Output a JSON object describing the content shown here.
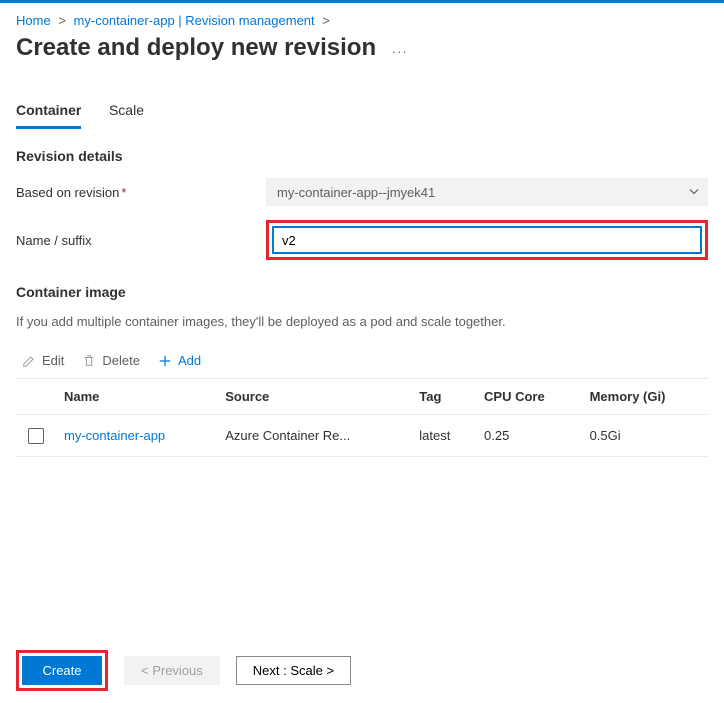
{
  "breadcrumb": {
    "home": "Home",
    "item": "my-container-app | Revision management"
  },
  "page": {
    "title": "Create and deploy new revision"
  },
  "tabs": {
    "container": "Container",
    "scale": "Scale"
  },
  "revision_details": {
    "title": "Revision details",
    "based_on_label": "Based on revision",
    "based_on_value": "my-container-app--jmyek41",
    "name_suffix_label": "Name / suffix",
    "name_suffix_value": "v2"
  },
  "container_image": {
    "title": "Container image",
    "helper": "If you add multiple container images, they'll be deployed as a pod and scale together."
  },
  "toolbar": {
    "edit": "Edit",
    "delete": "Delete",
    "add": "Add"
  },
  "table": {
    "headers": {
      "name": "Name",
      "source": "Source",
      "tag": "Tag",
      "cpu": "CPU Core",
      "memory": "Memory (Gi)"
    },
    "rows": [
      {
        "name": "my-container-app",
        "source": "Azure Container Re...",
        "tag": "latest",
        "cpu": "0.25",
        "memory": "0.5Gi"
      }
    ]
  },
  "footer": {
    "create": "Create",
    "previous": "< Previous",
    "next": "Next : Scale >"
  }
}
